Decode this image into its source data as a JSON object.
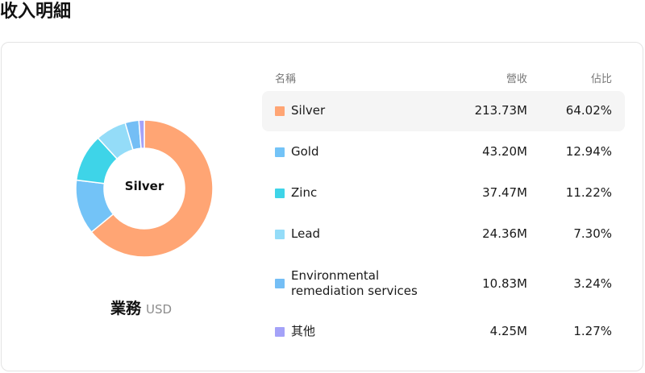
{
  "page": {
    "title": "收入明細"
  },
  "table": {
    "headers": {
      "name": "名稱",
      "revenue": "營收",
      "share": "佔比"
    }
  },
  "summary": {
    "label": "業務",
    "unit": "USD",
    "selected": "Silver"
  },
  "chart_data": {
    "type": "pie",
    "donut": true,
    "unit": "USD",
    "categories": [
      "Silver",
      "Gold",
      "Zinc",
      "Lead",
      "Environmental remediation services",
      "其他"
    ],
    "revenues": [
      "213.73M",
      "43.20M",
      "37.47M",
      "24.36M",
      "10.83M",
      "4.25M"
    ],
    "values": [
      213.73,
      43.2,
      37.47,
      24.36,
      10.83,
      4.25
    ],
    "percents": [
      "64.02%",
      "12.94%",
      "11.22%",
      "7.30%",
      "3.24%",
      "1.27%"
    ],
    "colors": [
      "#FFA574",
      "#73C3F7",
      "#3ED4E8",
      "#94DCF8",
      "#74BEF5",
      "#A4A2F8"
    ],
    "highlighted": "Silver"
  }
}
